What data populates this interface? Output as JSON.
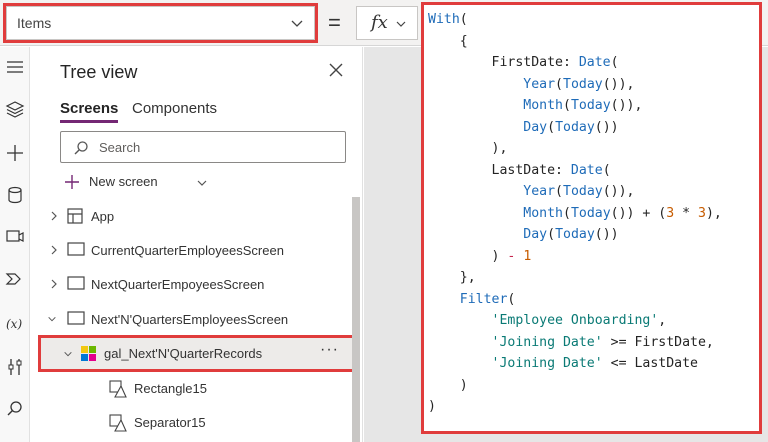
{
  "formula_bar": {
    "property": "Items",
    "equals": "=",
    "fx_label": "fx"
  },
  "tree_view": {
    "title": "Tree view",
    "tabs": [
      "Screens",
      "Components"
    ],
    "search_placeholder": "Search",
    "new_screen": "New screen",
    "items": [
      {
        "label": "App",
        "icon": "app-icon"
      },
      {
        "label": "CurrentQuarterEmployeesScreen",
        "icon": "screen-icon"
      },
      {
        "label": "NextQuarterEmpoyeesScreen",
        "icon": "screen-icon"
      },
      {
        "label": "Next'N'QuartersEmployeesScreen",
        "icon": "screen-icon"
      },
      {
        "label": "gal_Next'N'QuarterRecords",
        "icon": "gallery-icon",
        "selected": true
      },
      {
        "label": "Rectangle15",
        "icon": "shape-icon"
      },
      {
        "label": "Separator15",
        "icon": "shape-icon"
      }
    ],
    "more": "···"
  },
  "rail_icons": [
    "hamburger-icon",
    "layers-icon",
    "insert-icon",
    "data-icon",
    "media-icon",
    "power-automate-icon",
    "variables-icon",
    "advanced-tools-icon",
    "search-icon"
  ],
  "formula": {
    "lines": [
      "With(",
      "    {",
      "        FirstDate: Date(",
      "            Year(Today()),",
      "            Month(Today()),",
      "            Day(Today())",
      "        ),",
      "        LastDate: Date(",
      "            Year(Today()),",
      "            Month(Today()) + (3 * 3),",
      "            Day(Today())",
      "        ) - 1",
      "    },",
      "    Filter(",
      "        'Employee Onboarding',",
      "        'Joining Date' >= FirstDate,",
      "        'Joining Date' <= LastDate",
      "    )",
      ")"
    ]
  },
  "colors": {
    "highlight": "#e03c3c",
    "function": "#1e6bb8",
    "string": "#0a7a75",
    "number": "#c75c00",
    "tab_underline": "#742774"
  }
}
